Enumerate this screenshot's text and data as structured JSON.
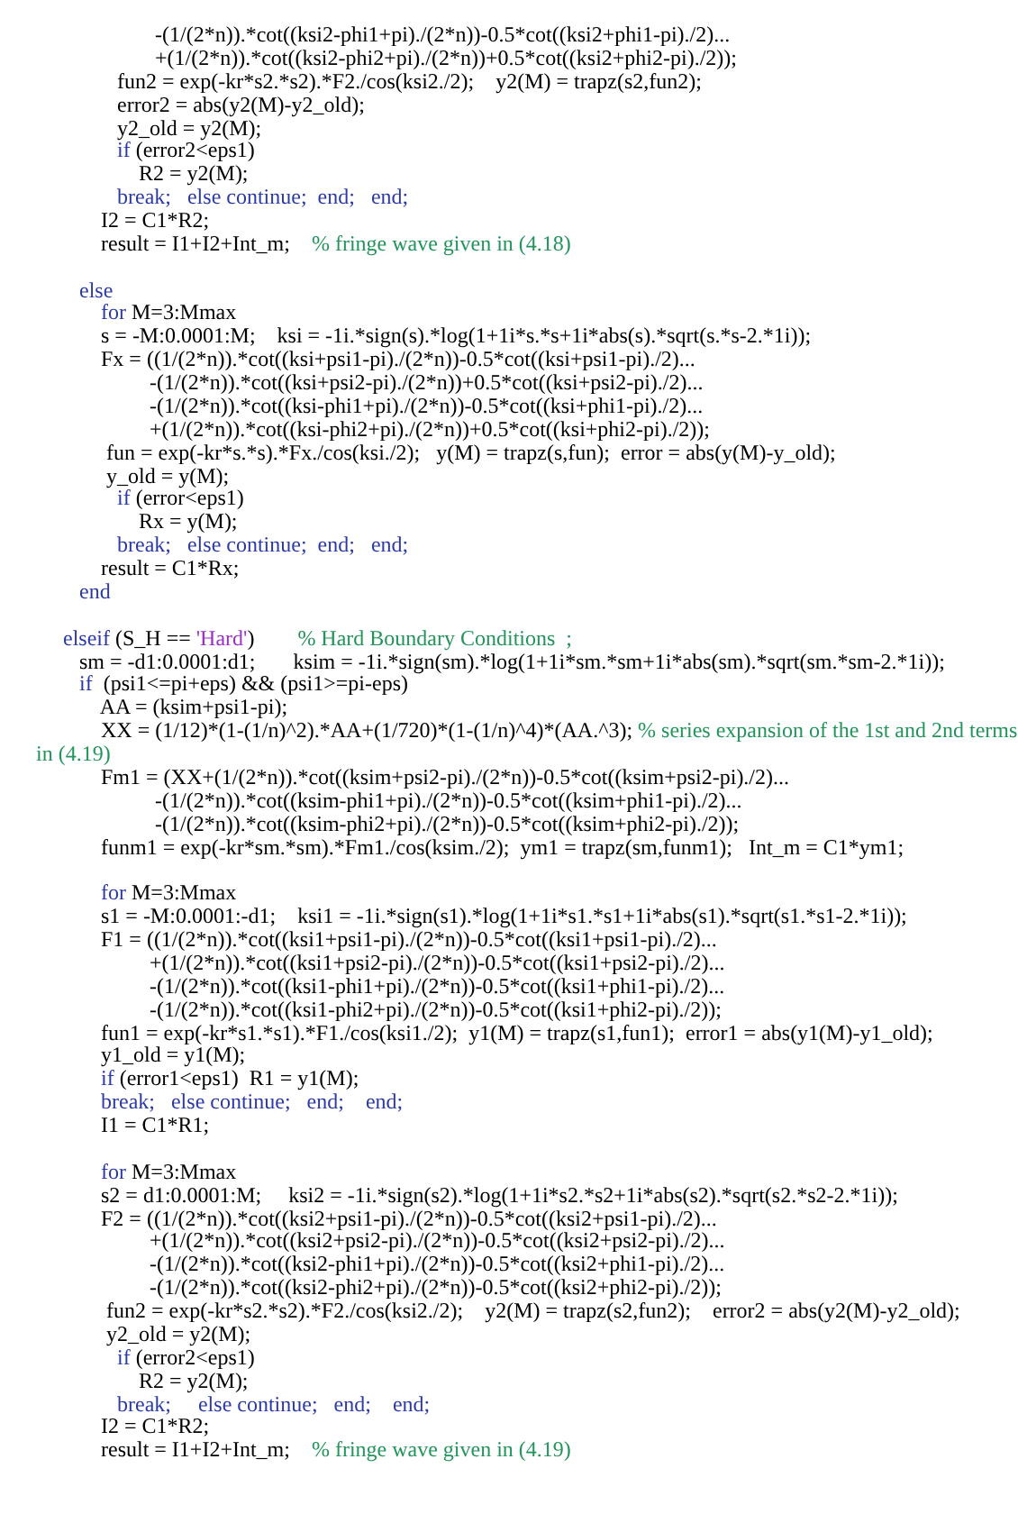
{
  "code_listing": {
    "lines": [
      {
        "segments": [
          {
            "kind": "code",
            "text": "                      -(1/(2*n)).*cot((ksi2-phi1+pi)./(2*n))-0.5*cot((ksi2+phi1-pi)./2)..."
          }
        ]
      },
      {
        "segments": [
          {
            "kind": "code",
            "text": "                      +(1/(2*n)).*cot((ksi2-phi2+pi)./(2*n))+0.5*cot((ksi2+phi2-pi)./2));"
          }
        ]
      },
      {
        "segments": [
          {
            "kind": "code",
            "text": "               fun2 = exp(-kr*s2.*s2).*F2./cos(ksi2./2);    y2(M) = trapz(s2,fun2);"
          }
        ]
      },
      {
        "segments": [
          {
            "kind": "code",
            "text": "               error2 = abs(y2(M)-y2_old);"
          }
        ]
      },
      {
        "segments": [
          {
            "kind": "code",
            "text": "               y2_old = y2(M);"
          }
        ]
      },
      {
        "segments": [
          {
            "kind": "keyword",
            "text": "               if"
          },
          {
            "kind": "code",
            "text": " (error2<eps1)"
          }
        ]
      },
      {
        "segments": [
          {
            "kind": "code",
            "text": "                   R2 = y2(M);"
          }
        ]
      },
      {
        "segments": [
          {
            "kind": "keyword",
            "text": "               break;   else continue;  end;   end;"
          }
        ]
      },
      {
        "segments": [
          {
            "kind": "code",
            "text": "            I2 = C1*R2;"
          }
        ]
      },
      {
        "segments": [
          {
            "kind": "code",
            "text": "            result = I1+I2+Int_m;    "
          },
          {
            "kind": "comment",
            "text": "% fringe wave given in (4.18)"
          }
        ]
      },
      {
        "gap_before": true,
        "segments": [
          {
            "kind": "keyword",
            "text": "        else"
          }
        ]
      },
      {
        "segments": [
          {
            "kind": "keyword",
            "text": "            for"
          },
          {
            "kind": "code",
            "text": " M=3:Mmax"
          }
        ]
      },
      {
        "segments": [
          {
            "kind": "code",
            "text": "            s = -M:0.0001:M;    ksi = -1i.*sign(s).*log(1+1i*s.*s+1i*abs(s).*sqrt(s.*s-2.*1i));"
          }
        ]
      },
      {
        "segments": [
          {
            "kind": "code",
            "text": "            Fx = ((1/(2*n)).*cot((ksi+psi1-pi)./(2*n))-0.5*cot((ksi+psi1-pi)./2)..."
          }
        ]
      },
      {
        "segments": [
          {
            "kind": "code",
            "text": "                     -(1/(2*n)).*cot((ksi+psi2-pi)./(2*n))+0.5*cot((ksi+psi2-pi)./2)..."
          }
        ]
      },
      {
        "segments": [
          {
            "kind": "code",
            "text": "                     -(1/(2*n)).*cot((ksi-phi1+pi)./(2*n))-0.5*cot((ksi+phi1-pi)./2)..."
          }
        ]
      },
      {
        "segments": [
          {
            "kind": "code",
            "text": "                     +(1/(2*n)).*cot((ksi-phi2+pi)./(2*n))+0.5*cot((ksi+phi2-pi)./2));"
          }
        ]
      },
      {
        "segments": [
          {
            "kind": "code",
            "text": "             fun = exp(-kr*s.*s).*Fx./cos(ksi./2);   y(M) = trapz(s,fun);  error = abs(y(M)-y_old);"
          }
        ]
      },
      {
        "segments": [
          {
            "kind": "code",
            "text": "             y_old = y(M);"
          }
        ]
      },
      {
        "segments": [
          {
            "kind": "keyword",
            "text": "               if"
          },
          {
            "kind": "code",
            "text": " (error<eps1)"
          }
        ]
      },
      {
        "segments": [
          {
            "kind": "code",
            "text": "                   Rx = y(M);"
          }
        ]
      },
      {
        "segments": [
          {
            "kind": "keyword",
            "text": "               break;   else continue;  end;   end;"
          }
        ]
      },
      {
        "segments": [
          {
            "kind": "code",
            "text": "            result = C1*Rx;"
          }
        ]
      },
      {
        "segments": [
          {
            "kind": "keyword",
            "text": "        end"
          }
        ]
      },
      {
        "gap_before": true,
        "segments": [
          {
            "kind": "keyword",
            "text": "     elseif"
          },
          {
            "kind": "code",
            "text": " (S_H == "
          },
          {
            "kind": "string",
            "text": "'Hard'"
          },
          {
            "kind": "code",
            "text": ")        "
          },
          {
            "kind": "comment",
            "text": "% Hard Boundary Conditions  ;"
          }
        ]
      },
      {
        "segments": [
          {
            "kind": "code",
            "text": "        sm = -d1:0.0001:d1;       ksim = -1i.*sign(sm).*log(1+1i*sm.*sm+1i*abs(sm).*sqrt(sm.*sm-2.*1i));"
          }
        ]
      },
      {
        "segments": [
          {
            "kind": "keyword",
            "text": "        if"
          },
          {
            "kind": "code",
            "text": "  (psi1<=pi+eps) && (psi1>=pi-eps)"
          }
        ]
      },
      {
        "segments": [
          {
            "kind": "code",
            "text": "            AA = (ksim+psi1-pi);"
          }
        ]
      },
      {
        "segments": [
          {
            "kind": "code",
            "text": "            XX = (1/12)*(1-(1/n)^2).*AA+(1/720)*(1-(1/n)^4)*(AA.^3); "
          },
          {
            "kind": "comment",
            "text": "% series expansion of the 1st and 2nd terms"
          }
        ]
      },
      {
        "segments": [
          {
            "kind": "comment",
            "text": "in (4.19)"
          }
        ]
      },
      {
        "segments": [
          {
            "kind": "code",
            "text": "            Fm1 = (XX+(1/(2*n)).*cot((ksim+psi2-pi)./(2*n))-0.5*cot((ksim+psi2-pi)./2)..."
          }
        ]
      },
      {
        "segments": [
          {
            "kind": "code",
            "text": "                      -(1/(2*n)).*cot((ksim-phi1+pi)./(2*n))-0.5*cot((ksim+phi1-pi)./2)..."
          }
        ]
      },
      {
        "segments": [
          {
            "kind": "code",
            "text": "                      -(1/(2*n)).*cot((ksim-phi2+pi)./(2*n))-0.5*cot((ksim+phi2-pi)./2));"
          }
        ]
      },
      {
        "segments": [
          {
            "kind": "code",
            "text": "            funm1 = exp(-kr*sm.*sm).*Fm1./cos(ksim./2);  ym1 = trapz(sm,funm1);   Int_m = C1*ym1;"
          }
        ]
      },
      {
        "gap_before": true,
        "segments": [
          {
            "kind": "keyword",
            "text": "            for"
          },
          {
            "kind": "code",
            "text": " M=3:Mmax"
          }
        ]
      },
      {
        "segments": [
          {
            "kind": "code",
            "text": "            s1 = -M:0.0001:-d1;    ksi1 = -1i.*sign(s1).*log(1+1i*s1.*s1+1i*abs(s1).*sqrt(s1.*s1-2.*1i));"
          }
        ]
      },
      {
        "segments": [
          {
            "kind": "code",
            "text": "            F1 = ((1/(2*n)).*cot((ksi1+psi1-pi)./(2*n))-0.5*cot((ksi1+psi1-pi)./2)..."
          }
        ]
      },
      {
        "segments": [
          {
            "kind": "code",
            "text": "                     +(1/(2*n)).*cot((ksi1+psi2-pi)./(2*n))-0.5*cot((ksi1+psi2-pi)./2)..."
          }
        ]
      },
      {
        "segments": [
          {
            "kind": "code",
            "text": "                     -(1/(2*n)).*cot((ksi1-phi1+pi)./(2*n))-0.5*cot((ksi1+phi1-pi)./2)..."
          }
        ]
      },
      {
        "segments": [
          {
            "kind": "code",
            "text": "                     -(1/(2*n)).*cot((ksi1-phi2+pi)./(2*n))-0.5*cot((ksi1+phi2-pi)./2));"
          }
        ]
      },
      {
        "segments": [
          {
            "kind": "code",
            "text": "            fun1 = exp(-kr*s1.*s1).*F1./cos(ksi1./2);  y1(M) = trapz(s1,fun1);  error1 = abs(y1(M)-y1_old);"
          }
        ]
      },
      {
        "segments": [
          {
            "kind": "code",
            "text": "            y1_old = y1(M);"
          }
        ]
      },
      {
        "segments": [
          {
            "kind": "keyword",
            "text": "            if"
          },
          {
            "kind": "code",
            "text": " (error1<eps1)  R1 = y1(M);"
          }
        ]
      },
      {
        "segments": [
          {
            "kind": "keyword",
            "text": "            break;   else continue;   end;    end;"
          }
        ]
      },
      {
        "segments": [
          {
            "kind": "code",
            "text": "            I1 = C1*R1;"
          }
        ]
      },
      {
        "gap_before": true,
        "segments": [
          {
            "kind": "keyword",
            "text": "            for"
          },
          {
            "kind": "code",
            "text": " M=3:Mmax"
          }
        ]
      },
      {
        "segments": [
          {
            "kind": "code",
            "text": "            s2 = d1:0.0001:M;     ksi2 = -1i.*sign(s2).*log(1+1i*s2.*s2+1i*abs(s2).*sqrt(s2.*s2-2.*1i));"
          }
        ]
      },
      {
        "segments": [
          {
            "kind": "code",
            "text": "            F2 = ((1/(2*n)).*cot((ksi2+psi1-pi)./(2*n))-0.5*cot((ksi2+psi1-pi)./2)..."
          }
        ]
      },
      {
        "segments": [
          {
            "kind": "code",
            "text": "                     +(1/(2*n)).*cot((ksi2+psi2-pi)./(2*n))-0.5*cot((ksi2+psi2-pi)./2)..."
          }
        ]
      },
      {
        "segments": [
          {
            "kind": "code",
            "text": "                     -(1/(2*n)).*cot((ksi2-phi1+pi)./(2*n))-0.5*cot((ksi2+phi1-pi)./2)..."
          }
        ]
      },
      {
        "segments": [
          {
            "kind": "code",
            "text": "                     -(1/(2*n)).*cot((ksi2-phi2+pi)./(2*n))-0.5*cot((ksi2+phi2-pi)./2));"
          }
        ]
      },
      {
        "segments": [
          {
            "kind": "code",
            "text": "             fun2 = exp(-kr*s2.*s2).*F2./cos(ksi2./2);    y2(M) = trapz(s2,fun2);    error2 = abs(y2(M)-y2_old);"
          }
        ]
      },
      {
        "segments": [
          {
            "kind": "code",
            "text": "             y2_old = y2(M);"
          }
        ]
      },
      {
        "segments": [
          {
            "kind": "keyword",
            "text": "               if"
          },
          {
            "kind": "code",
            "text": " (error2<eps1)"
          }
        ]
      },
      {
        "segments": [
          {
            "kind": "code",
            "text": "                   R2 = y2(M);"
          }
        ]
      },
      {
        "segments": [
          {
            "kind": "keyword",
            "text": "               break;     else continue;   end;    end;"
          }
        ]
      },
      {
        "segments": [
          {
            "kind": "code",
            "text": "            I2 = C1*R2;"
          }
        ]
      },
      {
        "segments": [
          {
            "kind": "code",
            "text": "            result = I1+I2+Int_m;    "
          },
          {
            "kind": "comment",
            "text": "% fringe wave given in (4.19)"
          }
        ]
      }
    ]
  }
}
